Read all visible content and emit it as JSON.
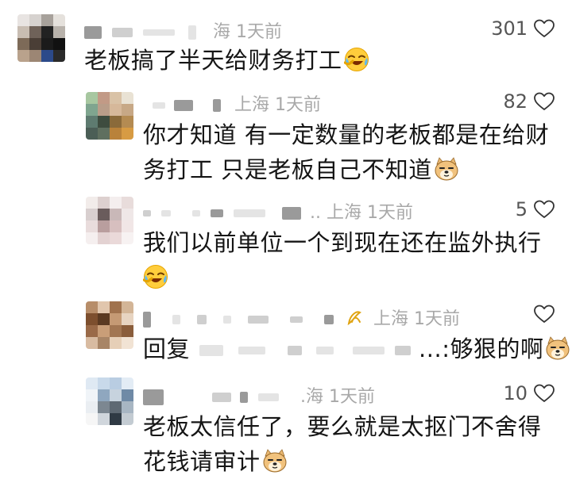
{
  "comments": [
    {
      "location_time": "海 1天前",
      "likes": "301",
      "text_lines": [
        "老板搞了半天给财务打工"
      ],
      "emoji": "crying-laughing-face-icon"
    },
    {
      "location_time": "上海 1天前",
      "likes": "82",
      "text_lines": [
        "你才知道 有一定数量的老板都是在给财",
        "务打工 只是老板自己不知道"
      ],
      "emoji": "doge-face-icon"
    },
    {
      "location_time": ".. 上海 1天前",
      "likes": "5",
      "text_lines": [
        "我们以前单位一个到现在还在监外执行",
        ""
      ],
      "emoji": "crying-laughing-face-icon"
    },
    {
      "location_time": "上海 1天前",
      "likes": "",
      "text_prefix": "回复",
      "text_suffix": "...:够狠的啊",
      "emoji": "doge-face-icon"
    },
    {
      "location_time": ".海 1天前",
      "likes": "10",
      "text_lines": [
        "老板太信任了，要么就是太抠门不舍得",
        "花钱请审计"
      ],
      "emoji": "doge-face-icon"
    }
  ]
}
